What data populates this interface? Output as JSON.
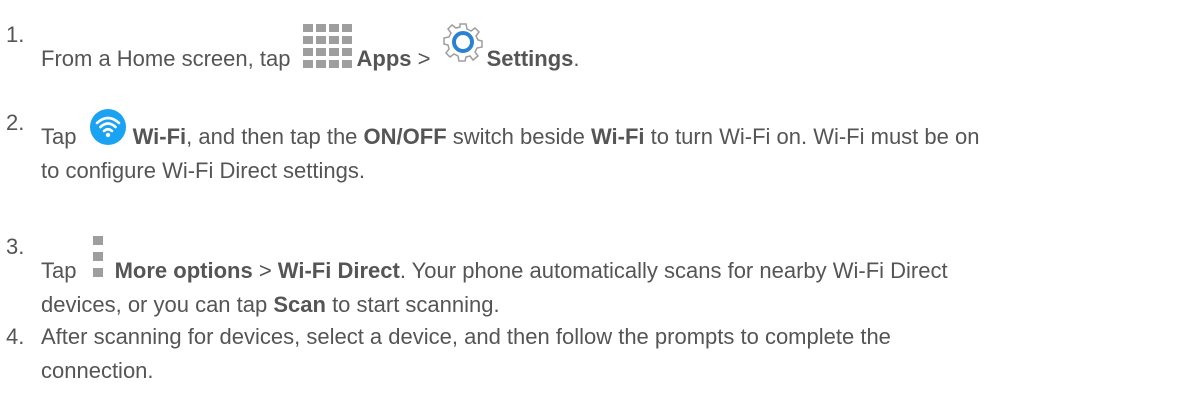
{
  "steps": [
    {
      "number": "1.",
      "parts": {
        "t1": "From a Home screen, tap ",
        "apps": "Apps",
        "sep": " > ",
        "settings": "Settings",
        "end": "."
      }
    },
    {
      "number": "2.",
      "parts": {
        "t1": "Tap ",
        "wifi": "Wi-Fi",
        "t2": ", and then tap the ",
        "onoff": "ON/OFF",
        "t3": " switch beside ",
        "wifi2": "Wi-Fi",
        "t4": " to turn Wi-Fi on. Wi-Fi must be on",
        "line2": "to configure Wi-Fi Direct settings."
      }
    },
    {
      "number": "3.",
      "parts": {
        "t1": "Tap ",
        "more": "More options",
        "sep": " > ",
        "direct": "Wi-Fi Direct",
        "t2": ". Your phone automatically scans for nearby Wi-Fi Direct",
        "line2a": "devices, or you can tap ",
        "scan": "Scan",
        "line2b": " to start scanning."
      }
    },
    {
      "number": "4.",
      "parts": {
        "line1": "After scanning for devices, select a device, and then follow the prompts to complete the",
        "line2": "connection."
      }
    }
  ],
  "icons": {
    "apps": "apps-grid-icon",
    "settings": "settings-gear-icon",
    "wifi": "wifi-icon",
    "more": "more-options-icon"
  },
  "colors": {
    "text": "#555555",
    "wifi_blue": "#1aa3f2",
    "icon_gray": "#9e9e9e"
  }
}
